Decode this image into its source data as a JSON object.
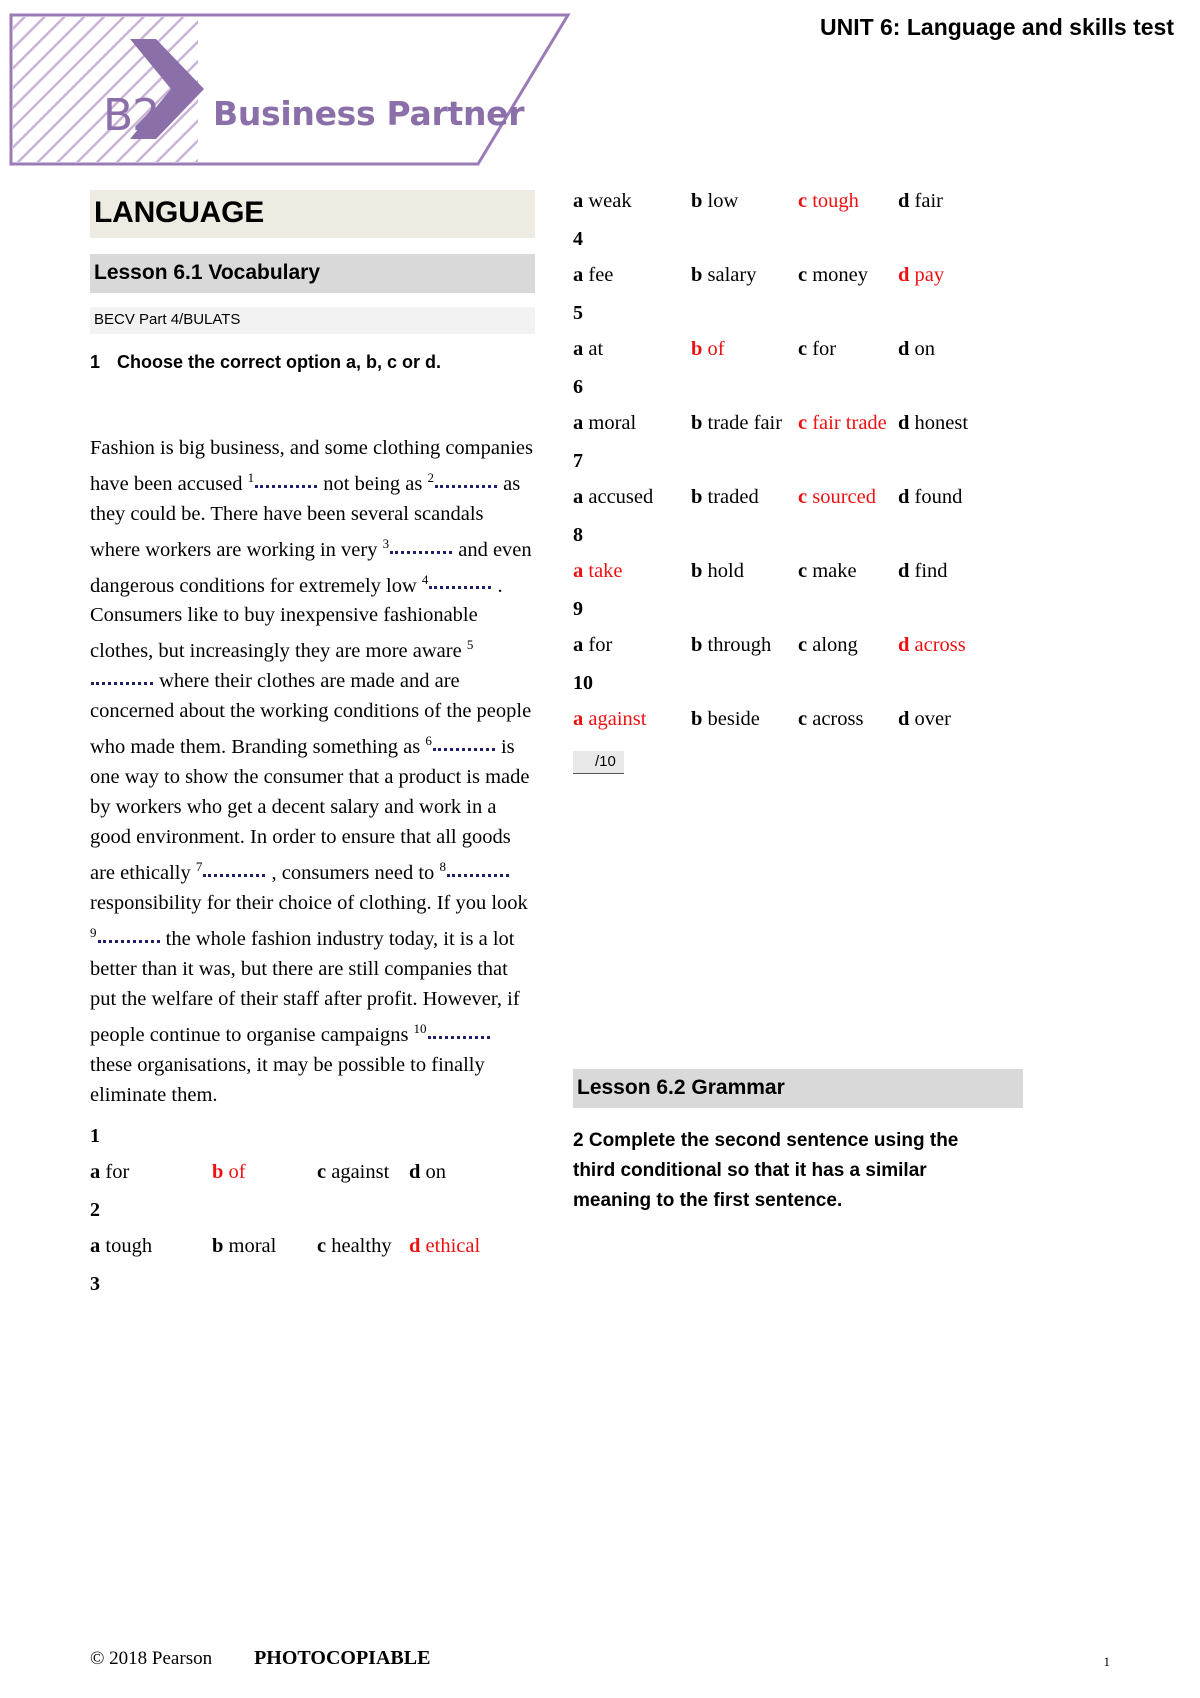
{
  "header": {
    "unit_title": "UNIT 6: Language and skills test",
    "logo": {
      "level": "B2",
      "brand": "Business Partner",
      "accent_color": "#8a6fa8"
    }
  },
  "left_column": {
    "section_title": "LANGUAGE",
    "lesson_title": "Lesson 6.1 Vocabulary",
    "exam_ref": "BECV Part 4/BULATS",
    "exercise_number": "1",
    "exercise_instruction": "Choose the correct option a, b, c or d.",
    "passage_segments": [
      {
        "type": "text",
        "value": "Fashion is big business, and some clothing companies have been accused "
      },
      {
        "type": "blank",
        "value": "1"
      },
      {
        "type": "text",
        "value": " not being as "
      },
      {
        "type": "blank",
        "value": "2"
      },
      {
        "type": "text",
        "value": " as they could be. There have been several scandals where workers are working in very "
      },
      {
        "type": "blank",
        "value": "3"
      },
      {
        "type": "text",
        "value": " and even dangerous conditions for extremely low "
      },
      {
        "type": "blank",
        "value": "4"
      },
      {
        "type": "text",
        "value": " . Consumers like to buy inexpensive fashionable clothes, but increasingly they are more aware "
      },
      {
        "type": "blank",
        "value": "5"
      },
      {
        "type": "text",
        "value": " where their clothes are made and are concerned about the working conditions of the people who made them. Branding something as "
      },
      {
        "type": "blank",
        "value": "6"
      },
      {
        "type": "text",
        "value": " is one way to show the consumer that a product is made by workers who get a decent salary and work in a good environment. In order to ensure that all goods are ethically "
      },
      {
        "type": "blank",
        "value": "7"
      },
      {
        "type": "text",
        "value": " , consumers need to "
      },
      {
        "type": "blank",
        "value": "8"
      },
      {
        "type": "text",
        "value": " responsibility for their choice of clothing. If you look "
      },
      {
        "type": "blank",
        "value": "9"
      },
      {
        "type": "text",
        "value": " the whole fashion industry today, it is a lot better than it was, but there are still companies that put the welfare of their staff after profit. However, if people continue to organise campaigns "
      },
      {
        "type": "blank",
        "value": "10"
      },
      {
        "type": "text",
        "value": " these organisations, it may be possible to finally eliminate them."
      }
    ],
    "questions": [
      {
        "number": "1",
        "options": [
          {
            "letter": "a",
            "text": "for",
            "correct": false
          },
          {
            "letter": "b",
            "text": "of",
            "correct": true
          },
          {
            "letter": "c",
            "text": "against",
            "correct": false
          },
          {
            "letter": "d",
            "text": "on",
            "correct": false
          }
        ]
      },
      {
        "number": "2",
        "options": [
          {
            "letter": "a",
            "text": "tough",
            "correct": false
          },
          {
            "letter": "b",
            "text": "moral",
            "correct": false
          },
          {
            "letter": "c",
            "text": "healthy",
            "correct": false
          },
          {
            "letter": "d",
            "text": "ethical",
            "correct": true
          }
        ]
      },
      {
        "number": "3",
        "options": []
      }
    ]
  },
  "right_column": {
    "questions": [
      {
        "number": "",
        "options": [
          {
            "letter": "a",
            "text": "weak",
            "correct": false
          },
          {
            "letter": "b",
            "text": "low",
            "correct": false
          },
          {
            "letter": "c",
            "text": "tough",
            "correct": true
          },
          {
            "letter": "d",
            "text": "fair",
            "correct": false
          }
        ]
      },
      {
        "number": "4",
        "options": [
          {
            "letter": "a",
            "text": "fee",
            "correct": false
          },
          {
            "letter": "b",
            "text": "salary",
            "correct": false
          },
          {
            "letter": "c",
            "text": "money",
            "correct": false
          },
          {
            "letter": "d",
            "text": "pay",
            "correct": true
          }
        ]
      },
      {
        "number": "5",
        "options": [
          {
            "letter": "a",
            "text": "at",
            "correct": false
          },
          {
            "letter": "b",
            "text": "of",
            "correct": true
          },
          {
            "letter": "c",
            "text": "for",
            "correct": false
          },
          {
            "letter": "d",
            "text": "on",
            "correct": false
          }
        ]
      },
      {
        "number": "6",
        "options": [
          {
            "letter": "a",
            "text": "moral",
            "correct": false
          },
          {
            "letter": "b",
            "text": "trade fair",
            "correct": false
          },
          {
            "letter": "c",
            "text": "fair trade",
            "correct": true
          },
          {
            "letter": "d",
            "text": "honest",
            "correct": false
          }
        ]
      },
      {
        "number": "7",
        "options": [
          {
            "letter": "a",
            "text": "accused",
            "correct": false
          },
          {
            "letter": "b",
            "text": "traded",
            "correct": false
          },
          {
            "letter": "c",
            "text": "sourced",
            "correct": true
          },
          {
            "letter": "d",
            "text": "found",
            "correct": false
          }
        ]
      },
      {
        "number": "8",
        "options": [
          {
            "letter": "a",
            "text": "take",
            "correct": true
          },
          {
            "letter": "b",
            "text": "hold",
            "correct": false
          },
          {
            "letter": "c",
            "text": "make",
            "correct": false
          },
          {
            "letter": "d",
            "text": "find",
            "correct": false
          }
        ]
      },
      {
        "number": "9",
        "options": [
          {
            "letter": "a",
            "text": "for",
            "correct": false
          },
          {
            "letter": "b",
            "text": "through",
            "correct": false
          },
          {
            "letter": "c",
            "text": "along",
            "correct": false
          },
          {
            "letter": "d",
            "text": "across",
            "correct": true
          }
        ]
      },
      {
        "number": "10",
        "options": [
          {
            "letter": "a",
            "text": "against",
            "correct": true
          },
          {
            "letter": "b",
            "text": "beside",
            "correct": false
          },
          {
            "letter": "c",
            "text": "across",
            "correct": false
          },
          {
            "letter": "d",
            "text": "over",
            "correct": false
          }
        ]
      }
    ],
    "score_label": "/10",
    "lesson2_title": "Lesson 6.2 Grammar",
    "exercise2_instruction": "2 Complete the second sentence using the third conditional so that it has a similar meaning to the first sentence."
  },
  "footer": {
    "copyright": "© 2018 Pearson",
    "photocopiable": "PHOTOCOPIABLE",
    "page_number": "1"
  }
}
